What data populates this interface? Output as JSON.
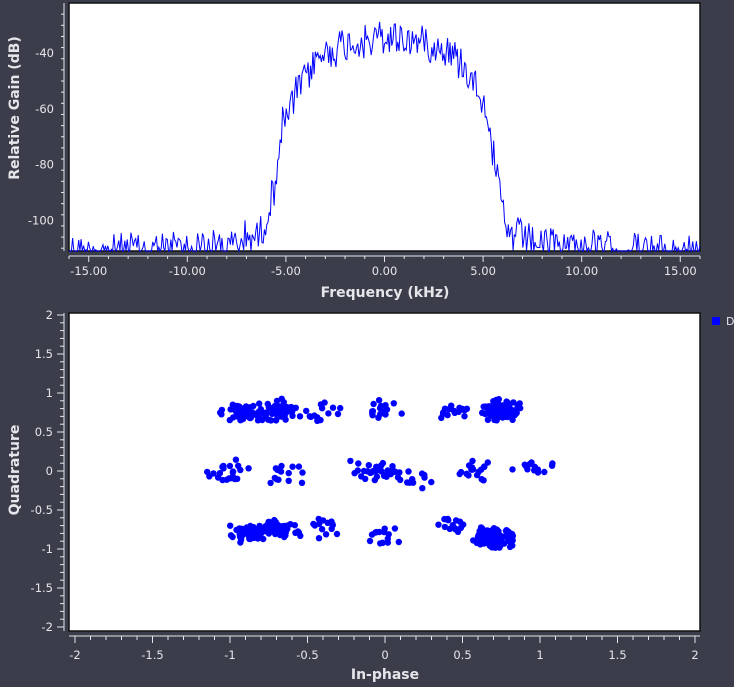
{
  "chart_data": [
    {
      "type": "line",
      "xlabel": "Frequency (kHz)",
      "ylabel": "Relative Gain (dB)",
      "xlim": [
        -16.0,
        16.0
      ],
      "ylim": [
        -111.0,
        -22.0
      ],
      "xticks": [
        -15,
        -10,
        -5,
        0,
        5,
        10,
        15
      ],
      "xtick_labels": [
        "-15.00",
        "-10.00",
        "-5.00",
        "0.00",
        "5.00",
        "10.00",
        "15.00"
      ],
      "yticks": [
        -40,
        -60,
        -80,
        -100
      ],
      "ytick_labels": [
        "-40",
        "-60",
        "-80",
        "-100"
      ],
      "grid": false,
      "series": [
        {
          "color": "#0000ff",
          "profile": {
            "x": [
              -16.0,
              -8.0,
              -6.2,
              -5.6,
              -5.2,
              -4.5,
              -3.5,
              -2.0,
              0.0,
              2.0,
              3.5,
              4.5,
              5.2,
              5.6,
              6.2,
              8.0,
              16.0
            ],
            "y": [
              -107,
              -105,
              -100,
              -84,
              -62,
              -50,
              -38,
              -32,
              -30,
              -31,
              -36,
              -44,
              -55,
              -76,
              -100,
              -104,
              -108
            ]
          }
        }
      ]
    },
    {
      "type": "scatter",
      "xlabel": "In-phase",
      "ylabel": "Quadrature",
      "xlim": [
        -2,
        2
      ],
      "ylim": [
        -2,
        2
      ],
      "xticks": [
        -2,
        -1.5,
        -1,
        -0.5,
        0,
        0.5,
        1,
        1.5,
        2
      ],
      "xtick_labels": [
        "-2",
        "-1.5",
        "-1",
        "-0.5",
        "0",
        "0.5",
        "1",
        "1.5",
        "2"
      ],
      "yticks": [
        2,
        1.5,
        1,
        0.5,
        0,
        -0.5,
        -1,
        -1.5,
        -2
      ],
      "ytick_labels": [
        "2",
        "1.5",
        "1",
        "0.5",
        "0",
        "-0.5",
        "-1",
        "-1.5",
        "-2"
      ],
      "grid": false,
      "legend": {
        "position": "right",
        "entries": [
          {
            "label": "D",
            "color": "#0000ff"
          }
        ]
      },
      "series": [
        {
          "color": "#0000ff",
          "clusters": [
            {
              "x": -0.9,
              "y": 0.75,
              "n": 55
            },
            {
              "x": -0.7,
              "y": 0.78,
              "n": 55
            },
            {
              "x": 0.75,
              "y": 0.78,
              "n": 95
            },
            {
              "x": -0.9,
              "y": -0.8,
              "n": 50
            },
            {
              "x": -0.7,
              "y": -0.75,
              "n": 45
            },
            {
              "x": 0.7,
              "y": -0.85,
              "n": 100
            },
            {
              "x": -0.4,
              "y": 0.72,
              "n": 14
            },
            {
              "x": -0.4,
              "y": -0.7,
              "n": 14
            },
            {
              "x": 0.45,
              "y": 0.75,
              "n": 16
            },
            {
              "x": 0.45,
              "y": -0.7,
              "n": 16
            },
            {
              "x": -1.0,
              "y": 0.0,
              "n": 22
            },
            {
              "x": -0.65,
              "y": -0.05,
              "n": 14
            },
            {
              "x": 0.6,
              "y": 0.0,
              "n": 18
            },
            {
              "x": 0.95,
              "y": 0.05,
              "n": 14
            },
            {
              "x": 0.0,
              "y": 0.0,
              "n": 26
            },
            {
              "x": 0.0,
              "y": 0.78,
              "n": 16
            },
            {
              "x": 0.0,
              "y": -0.85,
              "n": 14
            },
            {
              "x": -0.15,
              "y": 0.0,
              "n": 10
            },
            {
              "x": 0.2,
              "y": -0.1,
              "n": 10
            }
          ]
        }
      ]
    }
  ]
}
